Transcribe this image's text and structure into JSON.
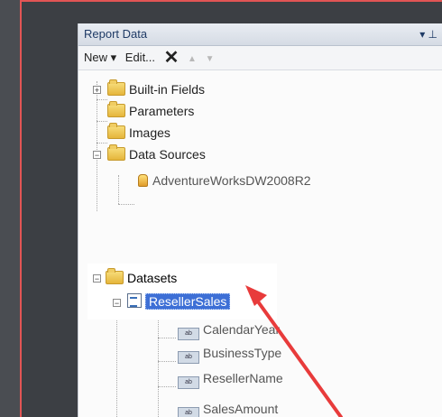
{
  "pane": {
    "title": "Report Data",
    "pin_glyph": "▾ ⊥"
  },
  "toolbar": {
    "new_label": "New ▾",
    "edit_label": "Edit...",
    "delete_glyph": "✕",
    "up_glyph": "▲",
    "down_glyph": "▼"
  },
  "tree": {
    "builtin": "Built-in Fields",
    "parameters": "Parameters",
    "images": "Images",
    "data_sources": "Data Sources",
    "data_source_item": "AdventureWorksDW2008R2",
    "datasets": "Datasets",
    "dataset_item": "ResellerSales",
    "fields": [
      "CalendarYear",
      "BusinessType",
      "ResellerName",
      "SalesAmount"
    ]
  },
  "colors": {
    "selection": "#3d6fd6",
    "annotation_arrow": "#e83b3b",
    "frame_border": "#e25555"
  }
}
